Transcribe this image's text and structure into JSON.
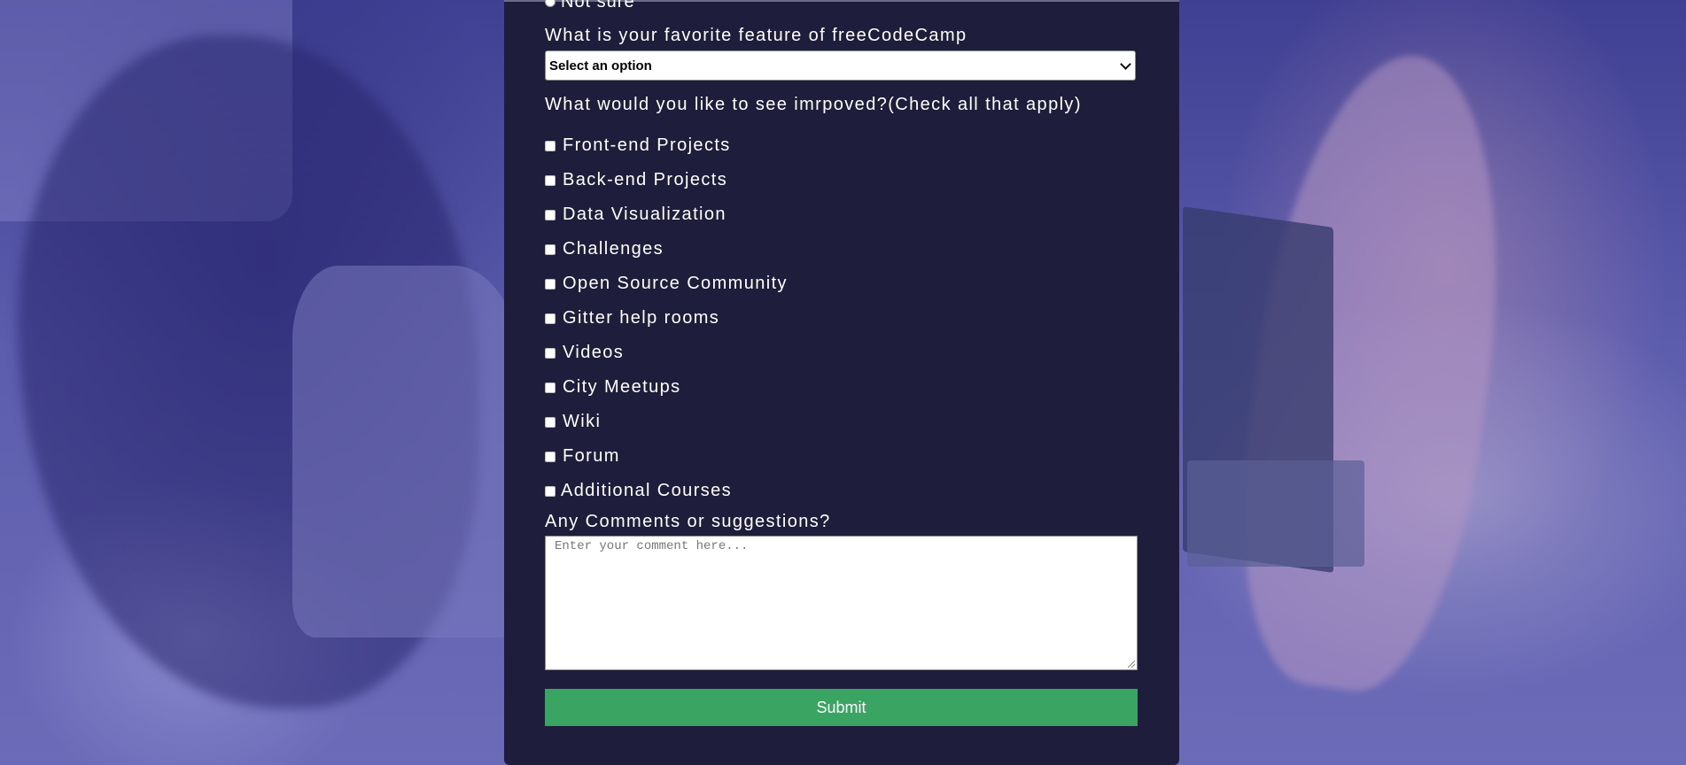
{
  "form": {
    "radio_partial_label": "Not sure",
    "favorite_feature_label": "What is your favorite feature of freeCodeCamp",
    "favorite_feature_select": {
      "selected": "Select an option"
    },
    "improve_label": "What would you like to see imrpoved?(Check all that apply)",
    "improve_options": [
      "Front-end Projects",
      "Back-end Projects",
      "Data Visualization",
      "Challenges",
      "Open Source Community",
      "Gitter help rooms",
      "Videos",
      "City Meetups",
      "Wiki",
      "Forum",
      "Additional Courses"
    ],
    "comments_label": "Any Comments or suggestions?",
    "comments_placeholder": "Enter your comment here...",
    "submit_label": "Submit"
  },
  "colors": {
    "panel_background": "#1e1e3c",
    "submit_background": "#3aa562",
    "page_background": "#5a5aa8"
  }
}
